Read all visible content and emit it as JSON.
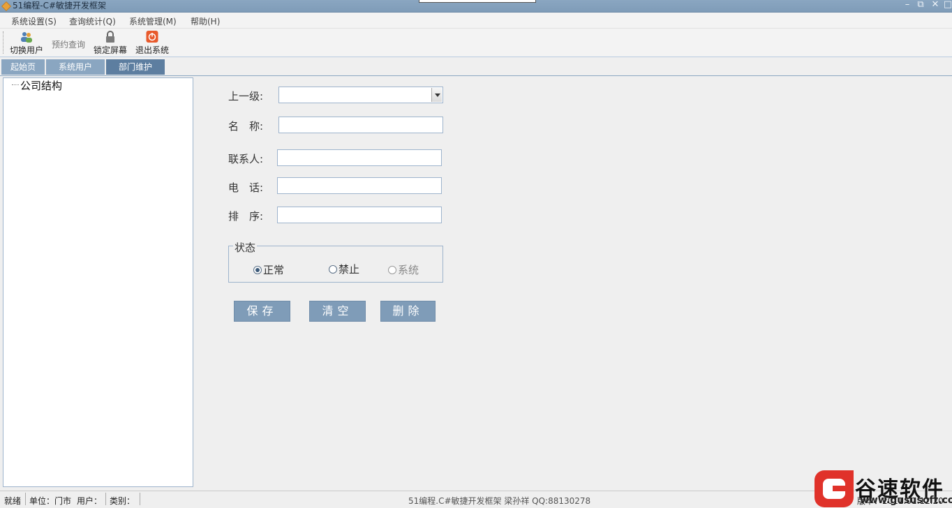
{
  "window": {
    "title": "51编程-C#敏捷开发框架",
    "controls": [
      "minimize-icon",
      "restore-icon",
      "close-icon"
    ]
  },
  "menu": [
    "系统设置(S)",
    "查询统计(Q)",
    "系统管理(M)",
    "帮助(H)"
  ],
  "toolbar": {
    "switch_user": "切换用户",
    "booking_query": "预约查询",
    "lock_screen": "锁定屏幕",
    "exit_system": "退出系统"
  },
  "tabs": [
    {
      "label": "起始页",
      "active": false
    },
    {
      "label": "系统用户",
      "active": false
    },
    {
      "label": "部门维护",
      "active": true
    }
  ],
  "tree": {
    "root": "公司结构"
  },
  "form": {
    "parent_label": "上一级:",
    "parent_value": "",
    "name_label": "名　称:",
    "name_value": "",
    "contact_label": "联系人:",
    "contact_value": "",
    "phone_label": "电　话:",
    "phone_value": "",
    "order_label": "排　序:",
    "order_value": ""
  },
  "status_group": {
    "title": "状态",
    "options": [
      {
        "label": "正常",
        "checked": true,
        "enabled": true
      },
      {
        "label": "禁止",
        "checked": false,
        "enabled": true
      },
      {
        "label": "系统",
        "checked": false,
        "enabled": false
      }
    ]
  },
  "buttons": {
    "save": "保存",
    "clear": "清空",
    "delete": "删除"
  },
  "statusbar": {
    "ready": "就绪",
    "unit": "单位：门市",
    "user": "用户：",
    "category": "类别：",
    "center": "51编程.C#敏捷开发框架 梁孙祥 QQ:88130278",
    "version": "版本：2011.01.12.20"
  },
  "watermark": {
    "brand": "谷速软件",
    "url": "www.gususoft.com"
  },
  "colors": {
    "accent": "#8aa6c1",
    "accent_dark": "#5d7ea0",
    "button": "#7f9cb8"
  }
}
